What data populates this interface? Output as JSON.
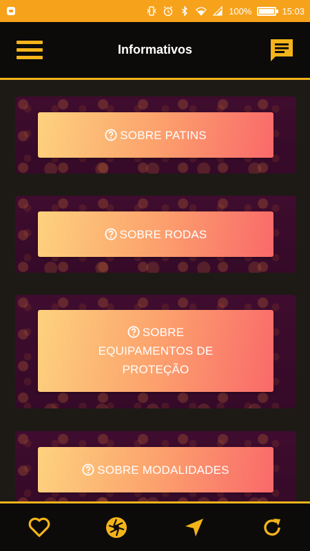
{
  "status_bar": {
    "battery_percent_text": "100%",
    "battery_level": 1.0,
    "time": "15:03",
    "icons": [
      "notification-icon",
      "vibrate-icon",
      "alarm-icon",
      "bluetooth-icon",
      "wifi-icon",
      "signal-icon",
      "battery-icon"
    ]
  },
  "header": {
    "title": "Informativos",
    "menu_icon": "hamburger-menu-icon",
    "chat_icon": "chat-message-icon"
  },
  "cards": [
    {
      "lines": [
        "SOBRE PATINS"
      ],
      "icon": "help-circle-icon"
    },
    {
      "lines": [
        "SOBRE RODAS"
      ],
      "icon": "help-circle-icon"
    },
    {
      "lines": [
        "SOBRE",
        "EQUIPAMENTOS DE",
        "PROTEÇÃO"
      ],
      "icon": "help-circle-icon"
    },
    {
      "lines": [
        "SOBRE MODALIDADES"
      ],
      "icon": "help-circle-icon"
    }
  ],
  "bottom_nav": {
    "tabs": [
      "heart-icon",
      "camera-aperture-icon",
      "navigation-arrow-icon",
      "refresh-icon"
    ]
  },
  "colors": {
    "accent": "#f4b41a",
    "status_bar": "#f7a21b",
    "header_bg": "#0c0b0a",
    "card_bg": "#3e0d2e",
    "button_gradient_start": "#fdd27e",
    "button_gradient_end": "#f9696a"
  }
}
